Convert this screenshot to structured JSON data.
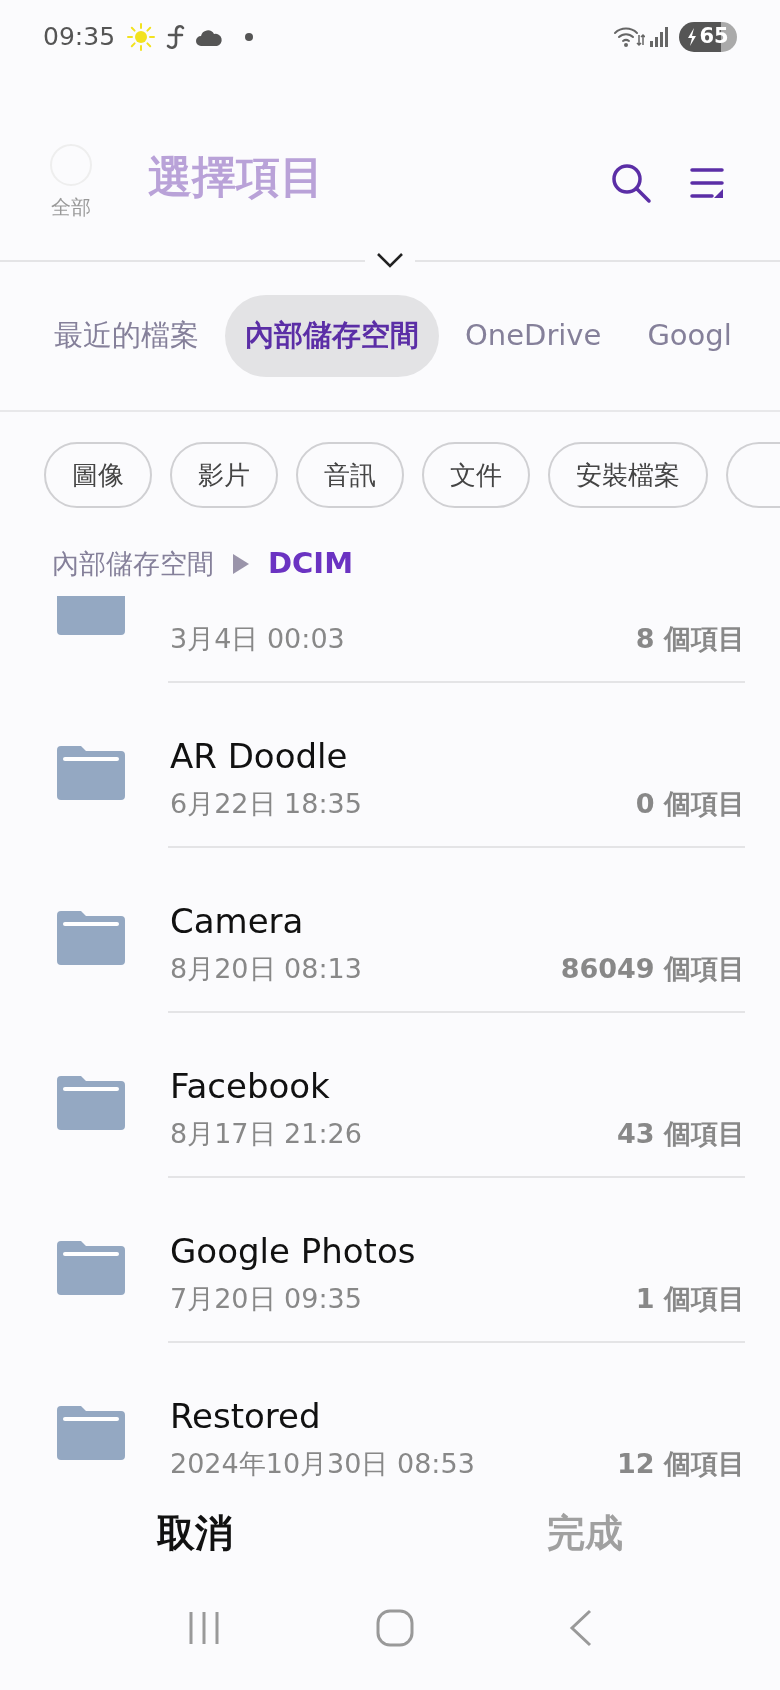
{
  "status_bar": {
    "time": "09:35",
    "battery": "65"
  },
  "header": {
    "select_all": {
      "label": "全部",
      "checked": false
    },
    "title": "選擇項目"
  },
  "storage_tabs": [
    {
      "label": "最近的檔案",
      "selected": false
    },
    {
      "label": "內部儲存空間",
      "selected": true
    },
    {
      "label": "OneDrive",
      "selected": false
    },
    {
      "label": "Googl",
      "selected": false
    }
  ],
  "filter_chips": [
    "圖像",
    "影片",
    "音訊",
    "文件",
    "安裝檔案"
  ],
  "breadcrumb": [
    "內部儲存空間",
    "DCIM"
  ],
  "folders": [
    {
      "date": "3月4日 00:03",
      "count": "8 個項目"
    },
    {
      "name": "AR Doodle",
      "date": "6月22日 18:35",
      "count": "0 個項目"
    },
    {
      "name": "Camera",
      "date": "8月20日 08:13",
      "count": "86049 個項目"
    },
    {
      "name": "Facebook",
      "date": "8月17日 21:26",
      "count": "43 個項目"
    },
    {
      "name": "Google Photos",
      "date": "7月20日 09:35",
      "count": "1 個項目"
    },
    {
      "name": "Restored",
      "date": "2024年10月30日 08:53",
      "count": "12 個項目"
    }
  ],
  "actions": [
    {
      "label": "取消",
      "disabled": false
    },
    {
      "label": "完成",
      "disabled": true
    }
  ]
}
